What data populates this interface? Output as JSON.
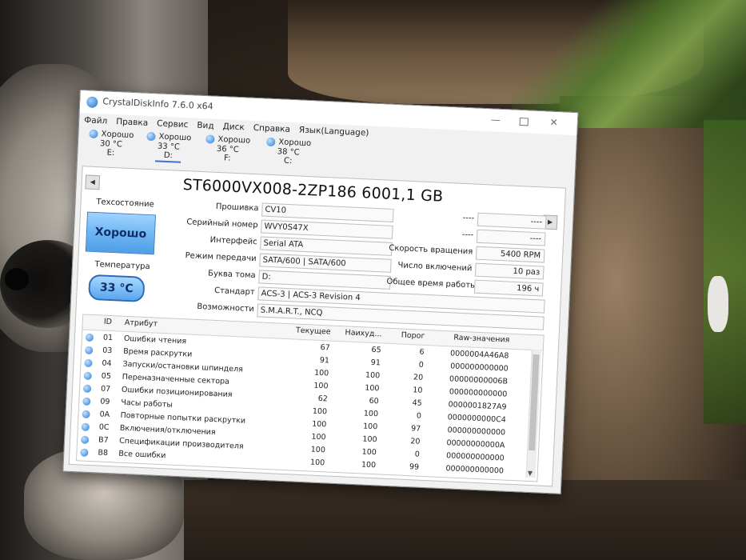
{
  "window": {
    "title": "CrystalDiskInfo 7.6.0 x64"
  },
  "menu": [
    "Файл",
    "Правка",
    "Сервис",
    "Вид",
    "Диск",
    "Справка",
    "Язык(Language)"
  ],
  "drives": [
    {
      "status": "Хорошо",
      "temp": "30 °C",
      "letter": "E:"
    },
    {
      "status": "Хорошо",
      "temp": "33 °C",
      "letter": "D:"
    },
    {
      "status": "Хорошо",
      "temp": "36 °C",
      "letter": "F:"
    },
    {
      "status": "Хорошо",
      "temp": "38 °C",
      "letter": "C:"
    }
  ],
  "disk": {
    "model": "ST6000VX008-2ZP186 6001,1 GB",
    "health_label": "Техсостояние",
    "health": "Хорошо",
    "temp_label": "Температура",
    "temp": "33 °C",
    "fields": {
      "firmware": {
        "label": "Прошивка",
        "value": "CV10"
      },
      "serial": {
        "label": "Серийный номер",
        "value": "WVY0S47X"
      },
      "interface": {
        "label": "Интерфейс",
        "value": "Serial ATA"
      },
      "transfer": {
        "label": "Режим передачи",
        "value": "SATA/600 | SATA/600"
      },
      "volume": {
        "label": "Буква тома",
        "value": "D:"
      },
      "standard": {
        "label": "Стандарт",
        "value": "ACS-3 | ACS-3 Revision 4"
      },
      "features": {
        "label": "Возможности",
        "value": "S.M.A.R.T., NCQ"
      }
    },
    "right": {
      "blank1": {
        "label": "----",
        "value": "----"
      },
      "blank2": {
        "label": "----",
        "value": "----"
      },
      "rpm": {
        "label": "Скорость вращения",
        "value": "5400 RPM"
      },
      "power_on_count": {
        "label": "Число включений",
        "value": "10 раз"
      },
      "power_on_hours": {
        "label": "Общее время работы",
        "value": "196 ч"
      }
    }
  },
  "smart": {
    "columns": {
      "id": "ID",
      "attr": "Атрибут",
      "cur": "Текущее",
      "worst": "Наихуд...",
      "thr": "Порог",
      "raw": "Raw-значения"
    },
    "rows": [
      {
        "id": "01",
        "attr": "Ошибки чтения",
        "cur": "67",
        "worst": "65",
        "thr": "6",
        "raw": "0000004A46A8"
      },
      {
        "id": "03",
        "attr": "Время раскрутки",
        "cur": "91",
        "worst": "91",
        "thr": "0",
        "raw": "000000000000"
      },
      {
        "id": "04",
        "attr": "Запуски/остановки шпинделя",
        "cur": "100",
        "worst": "100",
        "thr": "20",
        "raw": "00000000006B"
      },
      {
        "id": "05",
        "attr": "Переназначенные сектора",
        "cur": "100",
        "worst": "100",
        "thr": "10",
        "raw": "000000000000"
      },
      {
        "id": "07",
        "attr": "Ошибки позиционирования",
        "cur": "62",
        "worst": "60",
        "thr": "45",
        "raw": "0000001827A9"
      },
      {
        "id": "09",
        "attr": "Часы работы",
        "cur": "100",
        "worst": "100",
        "thr": "0",
        "raw": "0000000000C4"
      },
      {
        "id": "0A",
        "attr": "Повторные попытки раскрутки",
        "cur": "100",
        "worst": "100",
        "thr": "97",
        "raw": "000000000000"
      },
      {
        "id": "0C",
        "attr": "Включения/отключения",
        "cur": "100",
        "worst": "100",
        "thr": "20",
        "raw": "00000000000A"
      },
      {
        "id": "B7",
        "attr": "Спецификации производителя",
        "cur": "100",
        "worst": "100",
        "thr": "0",
        "raw": "000000000000"
      },
      {
        "id": "B8",
        "attr": "Все ошибки",
        "cur": "100",
        "worst": "100",
        "thr": "99",
        "raw": "000000000000"
      }
    ]
  }
}
